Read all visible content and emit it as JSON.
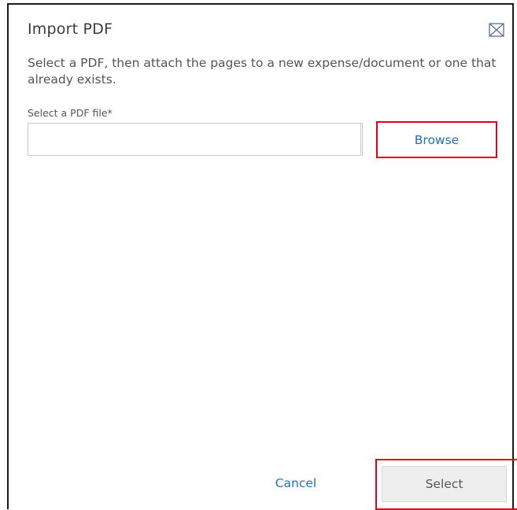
{
  "dialog": {
    "title": "Import PDF",
    "close_icon": "close-envelope-icon",
    "description": "Select a PDF, then attach the pages to a new expense/document or one that already exists."
  },
  "file_field": {
    "label": "Select a PDF file*",
    "value": "",
    "placeholder": ""
  },
  "buttons": {
    "browse": "Browse",
    "cancel": "Cancel",
    "select": "Select"
  },
  "colors": {
    "accent_link": "#1f73b7",
    "highlight_outline": "#e0001b",
    "disabled_button_bg": "#eeeeee",
    "text_primary": "#3b3b3b",
    "text_secondary": "#555555"
  }
}
